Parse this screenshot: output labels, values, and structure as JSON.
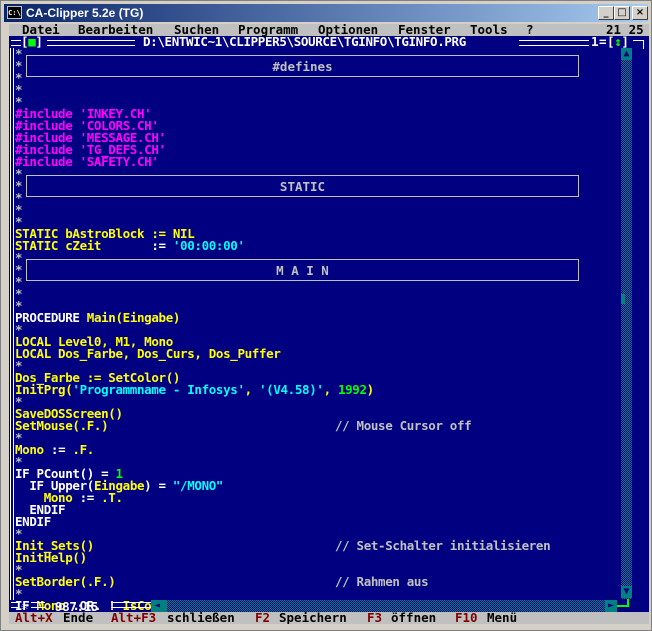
{
  "window": {
    "title": "CA-Clipper 5.2e (TG)",
    "app_icon": "C:\\",
    "controls": {
      "minimize": "_",
      "maximize": "□",
      "close": "×"
    }
  },
  "menu": {
    "items": [
      {
        "hotkey": "D",
        "rest": "atei"
      },
      {
        "hotkey": "B",
        "rest": "earbeiten"
      },
      {
        "hotkey": "S",
        "rest": "uchen"
      },
      {
        "hotkey": "P",
        "rest": "rogramm"
      },
      {
        "hotkey": "O",
        "rest": "ptionen"
      },
      {
        "hotkey": "F",
        "rest": "enster"
      },
      {
        "hotkey": "T",
        "rest": "ools"
      },
      {
        "hotkey": "?",
        "rest": ""
      }
    ],
    "cursor_pos": "21 25"
  },
  "editor": {
    "file_path": "D:\\ENTWIC~1\\CLIPPER5\\SOURCE\\TGINFO\\TGINFO.PRG",
    "window_number": "1",
    "close_box": "[■]",
    "resize_box": "[↕]",
    "position": "987:15",
    "headers": {
      "defines": "#defines",
      "static": "STATIC",
      "main": "M A I N"
    },
    "lines": {
      "inc1": "#include 'INKEY.CH'",
      "inc2": "#include 'COLORS.CH'",
      "inc3": "#include 'MESSAGE.CH'",
      "inc4": "#include 'TG_DEFS.CH'",
      "inc5": "#include 'SAFETY.CH'",
      "st1a": "STATIC bAstroBlock := ",
      "st1b": "NIL",
      "st2a": "STATIC cZeit       ",
      "st2b": ":= ",
      "st2c": "'00:00:00'",
      "proc_a": "PROCEDURE ",
      "proc_b": "Main(Eingabe)",
      "loc1": "LOCAL Level0, M1, Mono",
      "loc2": "LOCAL Dos_Farbe, Dos_Curs, Dos_Puffer",
      "farbe": "Dos_Farbe := SetColor()",
      "init_a": "InitPrg(",
      "init_b": "'Programmname - Infosys'",
      "init_c": ", ",
      "init_d": "'(V4.58)'",
      "init_e": ", ",
      "init_f": "1992",
      "init_g": ")",
      "save": "SaveDOSScreen()",
      "mouse": "SetMouse(.F.)",
      "mouse_cmt": "// Mouse Cursor off",
      "mono_a": "Mono ",
      "mono_b": ":= ",
      "mono_c": ".F.",
      "if1_a": "IF PCount() = ",
      "if1_b": "1",
      "if2_a": "  IF Upper(",
      "if2_b": "Eingabe",
      "if2_c": ") = ",
      "if2_d": "\"/MONO\"",
      "mono2_a": "    Mono ",
      "mono2_b": ":= ",
      "mono2_c": ".T.",
      "endif1": "  ENDIF",
      "endif2": "ENDIF",
      "sets": "Init_Sets()",
      "sets_cmt": "// Set-Schalter initialisieren",
      "help": "InitHelp()",
      "border": "SetBorder(.F.)",
      "border_cmt": "// Rahmen aus",
      "last_a": "IF ",
      "last_b": "Mono ",
      "last_c": ".OR. ! ",
      "last_d": "IsColor()",
      "star": "*"
    }
  },
  "statusbar": [
    {
      "key": "Alt+X",
      "label": "Ende"
    },
    {
      "key": "Alt+F3",
      "label": "schließen"
    },
    {
      "key": "F2",
      "label": "Speichern"
    },
    {
      "key": "F3",
      "label": "öffnen"
    },
    {
      "key": "F10",
      "label": "Menü"
    }
  ],
  "colors": {
    "background": "#000080",
    "include": "#ff00ff",
    "identifier": "#ffff00",
    "string": "#00ffff",
    "keyword": "#ffffff",
    "number": "#00ff00",
    "hotkey": "#800000"
  }
}
